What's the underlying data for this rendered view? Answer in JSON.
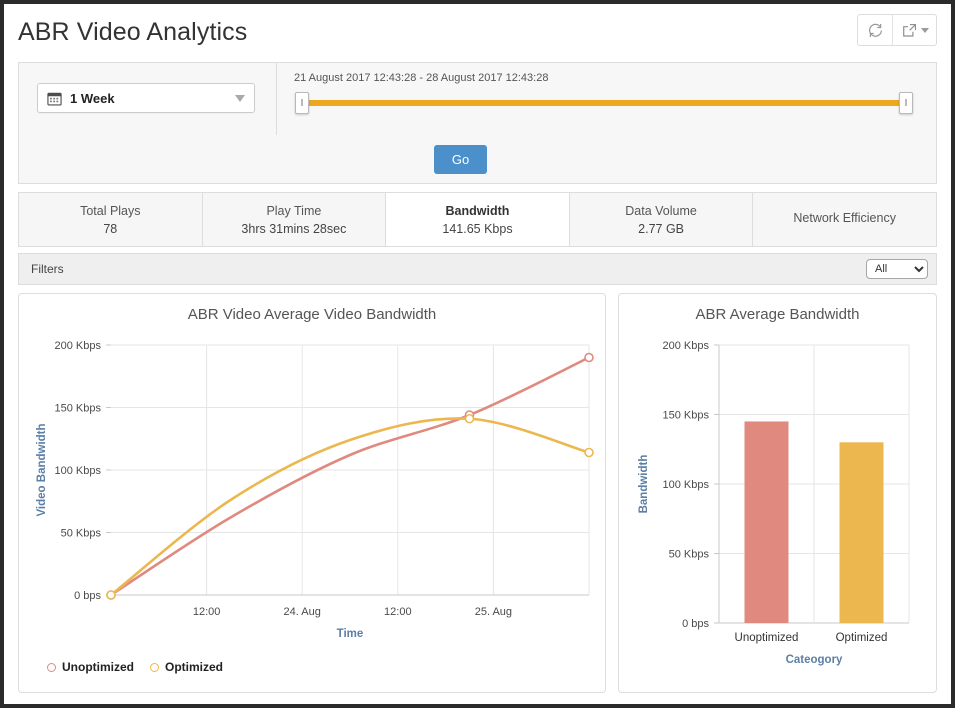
{
  "header": {
    "title": "ABR Video Analytics",
    "refresh_icon": "refresh-icon",
    "export_icon": "export-icon"
  },
  "controls": {
    "range_label": "1 Week",
    "calendar_icon": "calendar-icon",
    "date_range_text": "21 August 2017 12:43:28 - 28 August 2017 12:43:28",
    "slider_handle_glyph": "I",
    "go_label": "Go"
  },
  "metrics": [
    {
      "label": "Total Plays",
      "value": "78",
      "active": false
    },
    {
      "label": "Play Time",
      "value": "3hrs 31mins 28sec",
      "active": false
    },
    {
      "label": "Bandwidth",
      "value": "141.65 Kbps",
      "active": true
    },
    {
      "label": "Data Volume",
      "value": "2.77 GB",
      "active": false
    },
    {
      "label": "Network Efficiency",
      "value": "",
      "active": false
    }
  ],
  "filters": {
    "label": "Filters",
    "selected": "All",
    "options": [
      "All"
    ]
  },
  "colors": {
    "unoptimized": "#e0897e",
    "optimized": "#ecb74f",
    "accent_blue": "#4b8fcb",
    "slider_orange": "#eda820",
    "axis_title": "#5b7fa6"
  },
  "chart_data": [
    {
      "type": "line",
      "title": "ABR Video Average Video Bandwidth",
      "xlabel": "Time",
      "ylabel": "Video Bandwidth",
      "ylim": [
        0,
        200
      ],
      "yticks": [
        0,
        50,
        100,
        150,
        200
      ],
      "ytick_labels": [
        "0 bps",
        "50 Kbps",
        "100 Kbps",
        "150 Kbps",
        "200 Kbps"
      ],
      "xtick_labels": [
        "12:00",
        "24. Aug",
        "12:00",
        "25. Aug"
      ],
      "grid": true,
      "legend_position": "bottom-left",
      "x": [
        0,
        0.25,
        0.5,
        0.75,
        1.0
      ],
      "series": [
        {
          "name": "Unoptimized",
          "color": "#e0897e",
          "values": [
            0,
            62,
            112,
            144,
            190
          ],
          "markers": [
            0,
            144,
            190
          ]
        },
        {
          "name": "Optimized",
          "color": "#ecb74f",
          "values": [
            0,
            76,
            124,
            141,
            114
          ],
          "markers": [
            0,
            141,
            114
          ]
        }
      ]
    },
    {
      "type": "bar",
      "title": "ABR Average Bandwidth",
      "xlabel": "Cateogory",
      "ylabel": "Bandwidth",
      "ylim": [
        0,
        200
      ],
      "yticks": [
        0,
        50,
        100,
        150,
        200
      ],
      "ytick_labels": [
        "0 bps",
        "50 Kbps",
        "100 Kbps",
        "150 Kbps",
        "200 Kbps"
      ],
      "grid": true,
      "categories": [
        "Unoptimized",
        "Optimized"
      ],
      "values": [
        145,
        130
      ],
      "bar_colors": [
        "#e0897e",
        "#ecb74f"
      ]
    }
  ]
}
